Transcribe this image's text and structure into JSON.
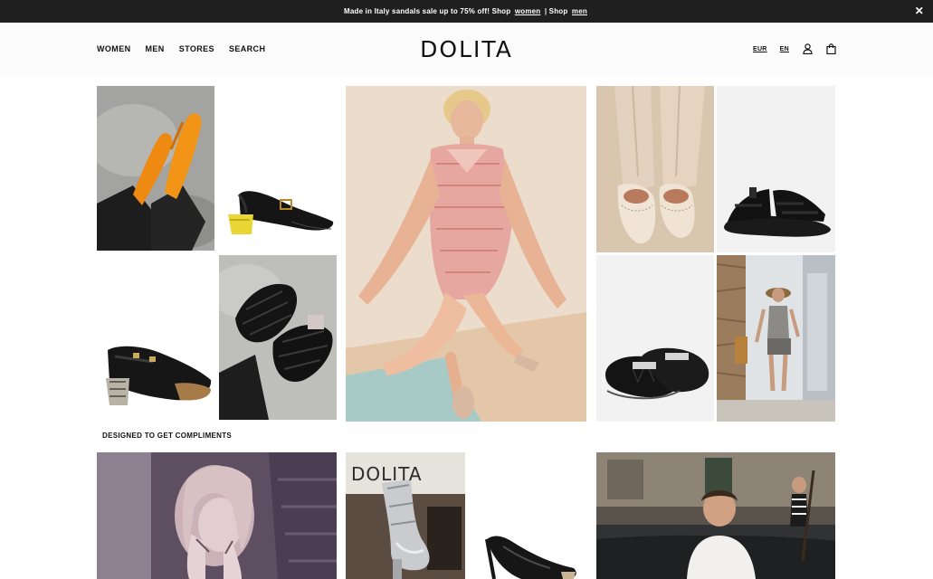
{
  "announcement": {
    "text_before": "Made in Italy sandals sale up to 75% off! Shop",
    "link_women": "women",
    "separator": "| Shop",
    "link_men": "men",
    "close_icon": "close-icon"
  },
  "header": {
    "nav": [
      "WOMEN",
      "MEN",
      "STORES",
      "SEARCH"
    ],
    "logo": "DOLITA",
    "currency": "EUR",
    "language": "EN",
    "account_icon": "user-icon",
    "cart_icon": "bag-icon"
  },
  "section": {
    "title": "DESIGNED TO GET COMPLIMENTS"
  },
  "store_sign": "DOLITA",
  "colors": {
    "announce_bg": "#1f1f1f",
    "header_bg": "#fbfbfb",
    "text": "#111111"
  }
}
